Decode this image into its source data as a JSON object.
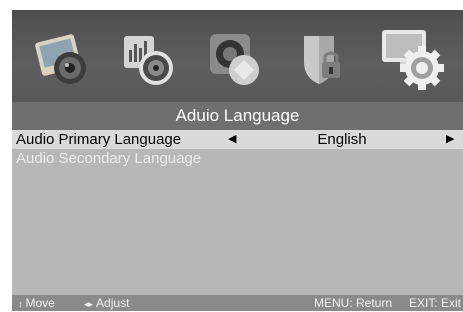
{
  "menu": {
    "title": "Aduio Language",
    "icons": [
      {
        "name": "picture-icon"
      },
      {
        "name": "sound-icon"
      },
      {
        "name": "channel-icon"
      },
      {
        "name": "lock-icon"
      },
      {
        "name": "setup-icon",
        "selected": true
      }
    ],
    "items": [
      {
        "label": "Audio Primary Language",
        "value": "English",
        "selected": true
      },
      {
        "label": "Audio Secondary Language",
        "value": "",
        "selected": false
      }
    ]
  },
  "footer": {
    "move": "Move",
    "adjust": "Adjust",
    "return": "MENU: Return",
    "exit": "EXIT: Exit"
  },
  "colors": {
    "background": "#b7b7b7",
    "title_bar": "#6f6f6f",
    "selected_row": "#dadada",
    "top_bar": "#5b5b5b"
  }
}
